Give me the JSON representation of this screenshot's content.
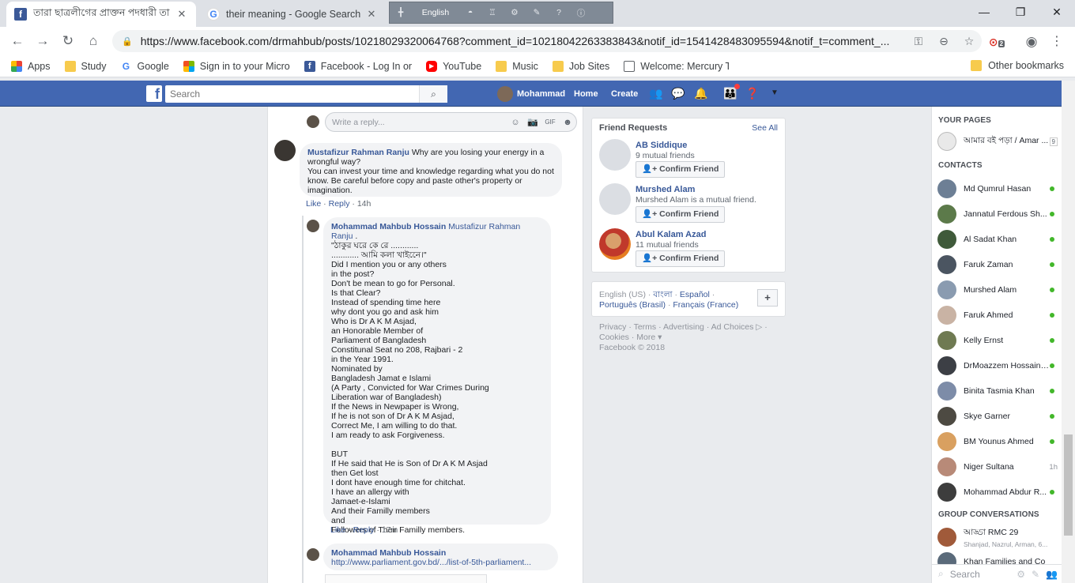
{
  "browser": {
    "tabs": [
      {
        "title": "তারা ছাত্রলীগের প্রাক্তন পদধারী তা",
        "active": true
      },
      {
        "title": "their meaning - Google Search",
        "active": false
      }
    ],
    "langbar_label": "English",
    "url": "https://www.facebook.com/drmahbub/posts/10218029320064768?comment_id=10218042263383843&notif_id=1541428483095594&notif_t=comment_...",
    "ext_badge": "2",
    "bookmarks": [
      "Apps",
      "Study",
      "Google",
      "Sign in to your Micro",
      "Facebook - Log In or",
      "YouTube",
      "Music",
      "Job Sites",
      "Welcome: Mercury To"
    ],
    "other_bookmarks": "Other bookmarks"
  },
  "fb": {
    "search_placeholder": "Search",
    "user_name": "Mohammad",
    "nav": {
      "home": "Home",
      "create": "Create"
    }
  },
  "feed": {
    "reply_placeholder": "Write a reply...",
    "comment1": {
      "author": "Mustafizur Rahman Ranju",
      "lines": [
        " Why are you losing your energy in a",
        "wrongful way?",
        "You can invest your time and knowledge regarding what you do not",
        "know. Be careful before copy and paste other's property or",
        "imagination."
      ],
      "like": "Like",
      "reply": "Reply",
      "time": "14h"
    },
    "reply1": {
      "author": "Mohammad Mahbub Hossain",
      "mention": "Mustafizur Rahman Ranju",
      "lines": [
        "\"ঠাকুর ঘরে কে রে ............",
        "............ আমি কলা খাইনেে।\"",
        "Did I mention you or any others",
        "in the post?",
        "Don't be mean to go for Personal.",
        "Is that Clear?",
        "Instead of spending time here",
        "why dont you go and ask him",
        "Who is Dr A K M Asjad,",
        "an Honorable Member of",
        "Parliament of Bangladesh",
        "Constitunal Seat no 208, Rajbari - 2",
        "in the Year 1991.",
        "Nominated by",
        "Bangladesh Jamat e Islami",
        "(A Party , Convicted for War Crimes During",
        "Liberation war of Bangladesh)",
        "If the News in Newpaper is Wrong,",
        "If he is not son of Dr A K M Asjad,",
        "Correct Me, I am willing to do that.",
        "I am ready to ask Forgiveness.",
        "",
        "BUT",
        "If He said that He is Son of Dr A K M Asjad",
        "then Get lost",
        "I dont have enough time for chitchat.",
        "I have an allergy with",
        "Jamaet-e-Islami",
        "And their Familly members",
        "and",
        "Followers of Their Familly members."
      ],
      "like": "Like",
      "reply": "Reply",
      "time": "17m"
    },
    "reply2": {
      "author": "Mohammad Mahbub Hossain",
      "link": "http://www.parliament.gov.bd/.../list-of-5th-parliament..."
    }
  },
  "friend_requests": {
    "title": "Friend Requests",
    "see_all": "See All",
    "confirm_label": "Confirm Friend",
    "items": [
      {
        "name": "AB Siddique",
        "sub": "9 mutual friends"
      },
      {
        "name": "Murshed Alam",
        "sub": "Murshed Alam is a mutual friend."
      },
      {
        "name": "Abul Kalam Azad",
        "sub": "11 mutual friends"
      }
    ]
  },
  "languages": {
    "line1": [
      "English (US)",
      "বাংলা",
      "Español"
    ],
    "line2": [
      "Português (Brasil)",
      "Français (France)"
    ],
    "add": "+"
  },
  "footer": {
    "line1": [
      "Privacy",
      "Terms",
      "Advertising",
      "Ad Choices"
    ],
    "line2": [
      "Cookies",
      "More"
    ],
    "copyright": "Facebook © 2018"
  },
  "chat": {
    "your_pages_label": "YOUR PAGES",
    "page_name": "আমার বই পড়া / Amar ...",
    "page_count": "9",
    "contacts_label": "CONTACTS",
    "contacts": [
      {
        "name": "Md Qumrul Hasan",
        "status": "online",
        "color": "#6d7f95"
      },
      {
        "name": "Jannatul Ferdous Sh...",
        "status": "online",
        "color": "#5c7a4a"
      },
      {
        "name": "Al Sadat Khan",
        "status": "online",
        "color": "#3f5a3a"
      },
      {
        "name": "Faruk Zaman",
        "status": "online",
        "color": "#4b5561"
      },
      {
        "name": "Murshed Alam",
        "status": "online",
        "color": "#8a9bb0"
      },
      {
        "name": "Faruk Ahmed",
        "status": "online",
        "color": "#c9b3a4"
      },
      {
        "name": "Kelly Ernst",
        "status": "online",
        "color": "#6f7a52"
      },
      {
        "name": "DrMoazzem Hossain ...",
        "status": "online",
        "color": "#3c3f45"
      },
      {
        "name": "Binita Tasmia Khan",
        "status": "online",
        "color": "#7d8ca8"
      },
      {
        "name": "Skye Garner",
        "status": "online",
        "color": "#4d4a42"
      },
      {
        "name": "BM Younus Ahmed",
        "status": "online",
        "color": "#d9a060"
      },
      {
        "name": "Niger Sultana",
        "status": "1h",
        "color": "#b88a78"
      },
      {
        "name": "Mohammad Abdur R...",
        "status": "online",
        "color": "#3d3d3d"
      }
    ],
    "group_label": "GROUP CONVERSATIONS",
    "groups": [
      {
        "name": "আড্ডা RMC 29",
        "sub": "Shanjad, Nazrul, Arman, 6..."
      },
      {
        "name": "Khan Families and Co",
        "sub": ""
      }
    ],
    "search_placeholder": "Search"
  }
}
